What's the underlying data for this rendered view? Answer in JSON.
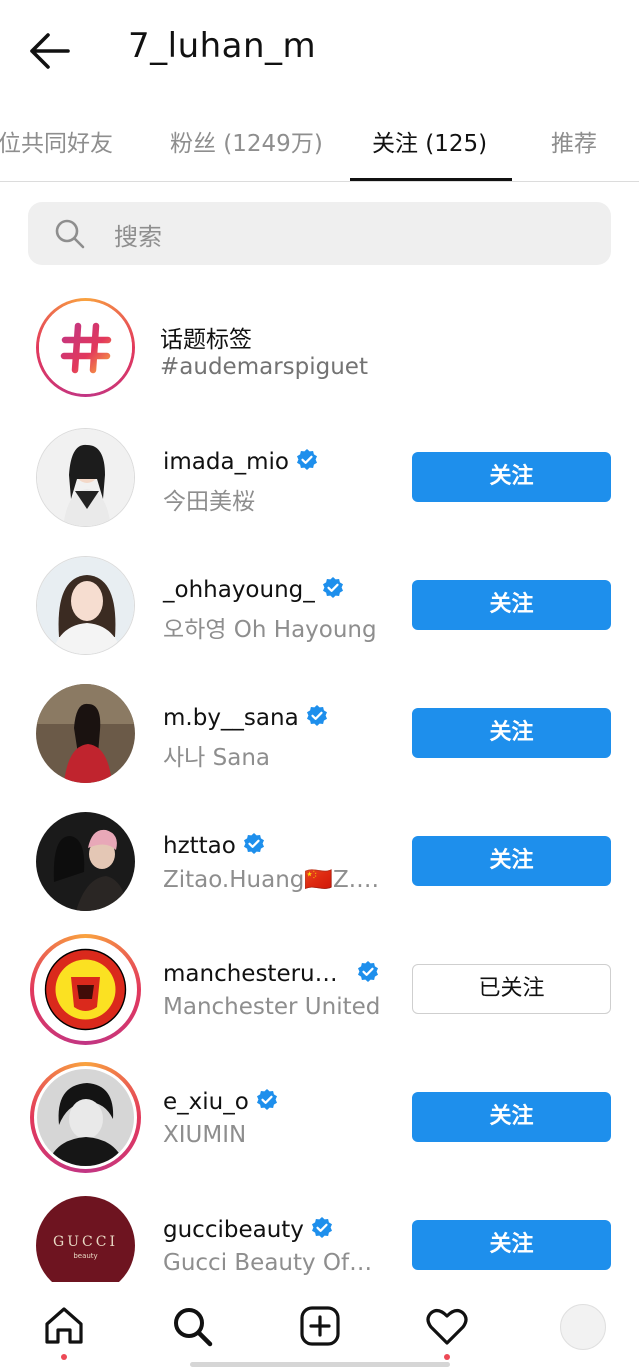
{
  "header": {
    "title": "7_luhan_m",
    "back_icon": "arrow-left-icon"
  },
  "tabs": [
    {
      "label": "位共同好友",
      "active": false
    },
    {
      "label": "粉丝 (1249万)",
      "active": false
    },
    {
      "label": "关注 (125)",
      "active": true
    },
    {
      "label": "推荐",
      "active": false
    }
  ],
  "search": {
    "placeholder": "搜索",
    "icon": "search-icon"
  },
  "hashtag": {
    "label": "话题标签",
    "tag": "#audemarspiguet"
  },
  "users": [
    {
      "username": "imada_mio",
      "name": "今田美桜",
      "verified": true,
      "button": "关注",
      "following": false
    },
    {
      "username": "_ohhayoung_",
      "name": "오하영 Oh Hayoung",
      "verified": true,
      "button": "关注",
      "following": false
    },
    {
      "username": "m.by__sana",
      "name": "사나 Sana",
      "verified": true,
      "button": "关注",
      "following": false
    },
    {
      "username": "hzttao",
      "name": "Zitao.Huang🇨🇳Z.…",
      "verified": true,
      "button": "关注",
      "following": false
    },
    {
      "username": "manchesteru…",
      "name": "Manchester United",
      "verified": true,
      "button": "已关注",
      "following": true
    },
    {
      "username": "e_xiu_o",
      "name": "XIUMIN",
      "verified": true,
      "button": "关注",
      "following": false
    },
    {
      "username": "guccibeauty",
      "name": "Gucci Beauty Of…",
      "verified": true,
      "button": "关注",
      "following": false
    }
  ],
  "logos": {
    "gucci": "GUCCI",
    "gucci_sub": "beauty"
  },
  "nav": [
    "home-icon",
    "search-icon",
    "create-icon",
    "heart-icon",
    "profile-icon"
  ],
  "colors": {
    "accent": "#1e8fec",
    "verified": "#1e8fec",
    "text": "#262626",
    "muted": "#8e8e8e"
  }
}
